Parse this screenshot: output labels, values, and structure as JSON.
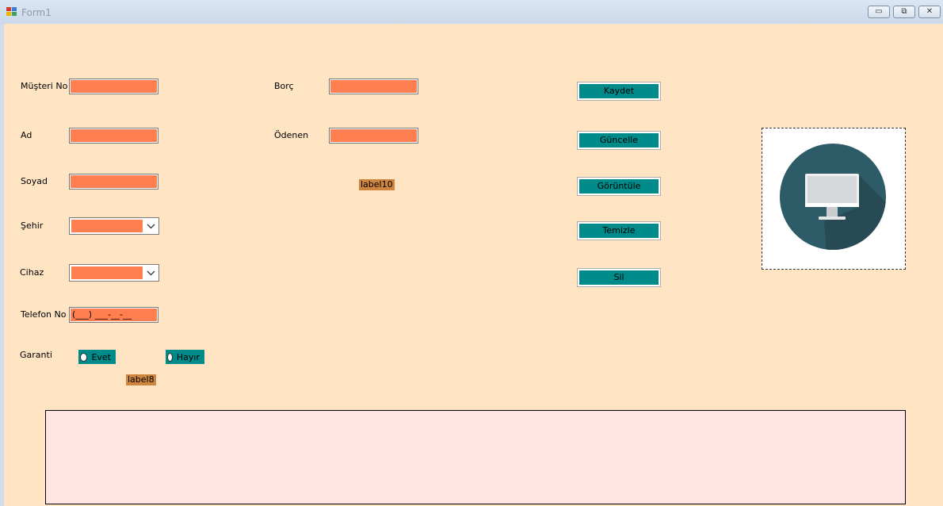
{
  "window": {
    "title": "Form1",
    "controls": {
      "minimize": "▭",
      "maximize": "⧉",
      "close": "✕"
    }
  },
  "form": {
    "musteri_no": {
      "label": "Müşteri No",
      "value": ""
    },
    "ad": {
      "label": "Ad",
      "value": ""
    },
    "soyad": {
      "label": "Soyad",
      "value": ""
    },
    "sehir": {
      "label": "Şehir",
      "value": ""
    },
    "cihaz": {
      "label": "Cihaz",
      "value": ""
    },
    "telefon": {
      "label": "Telefon No",
      "value": "(___) ___-__-__"
    },
    "garanti": {
      "label": "Garanti",
      "options": [
        "Evet",
        "Hayır"
      ]
    },
    "borc": {
      "label": "Borç",
      "value": ""
    },
    "odenen": {
      "label": "Ödenen",
      "value": ""
    },
    "label8": "label8",
    "label10": "label10"
  },
  "buttons": {
    "kaydet": "Kaydet",
    "guncelle": "Güncelle",
    "goruntule": "Görüntüle",
    "temizle": "Temizle",
    "sil": "Sil"
  },
  "picture": {
    "icon": "monitor-icon"
  },
  "colors": {
    "form_bg": "#ffe4c4",
    "input_fill": "#ff7f50",
    "button_fill": "#008b8b",
    "label_badge": "#cd853f",
    "grid_bg": "#ffe4e1",
    "icon_circle": "#2e5b68"
  }
}
